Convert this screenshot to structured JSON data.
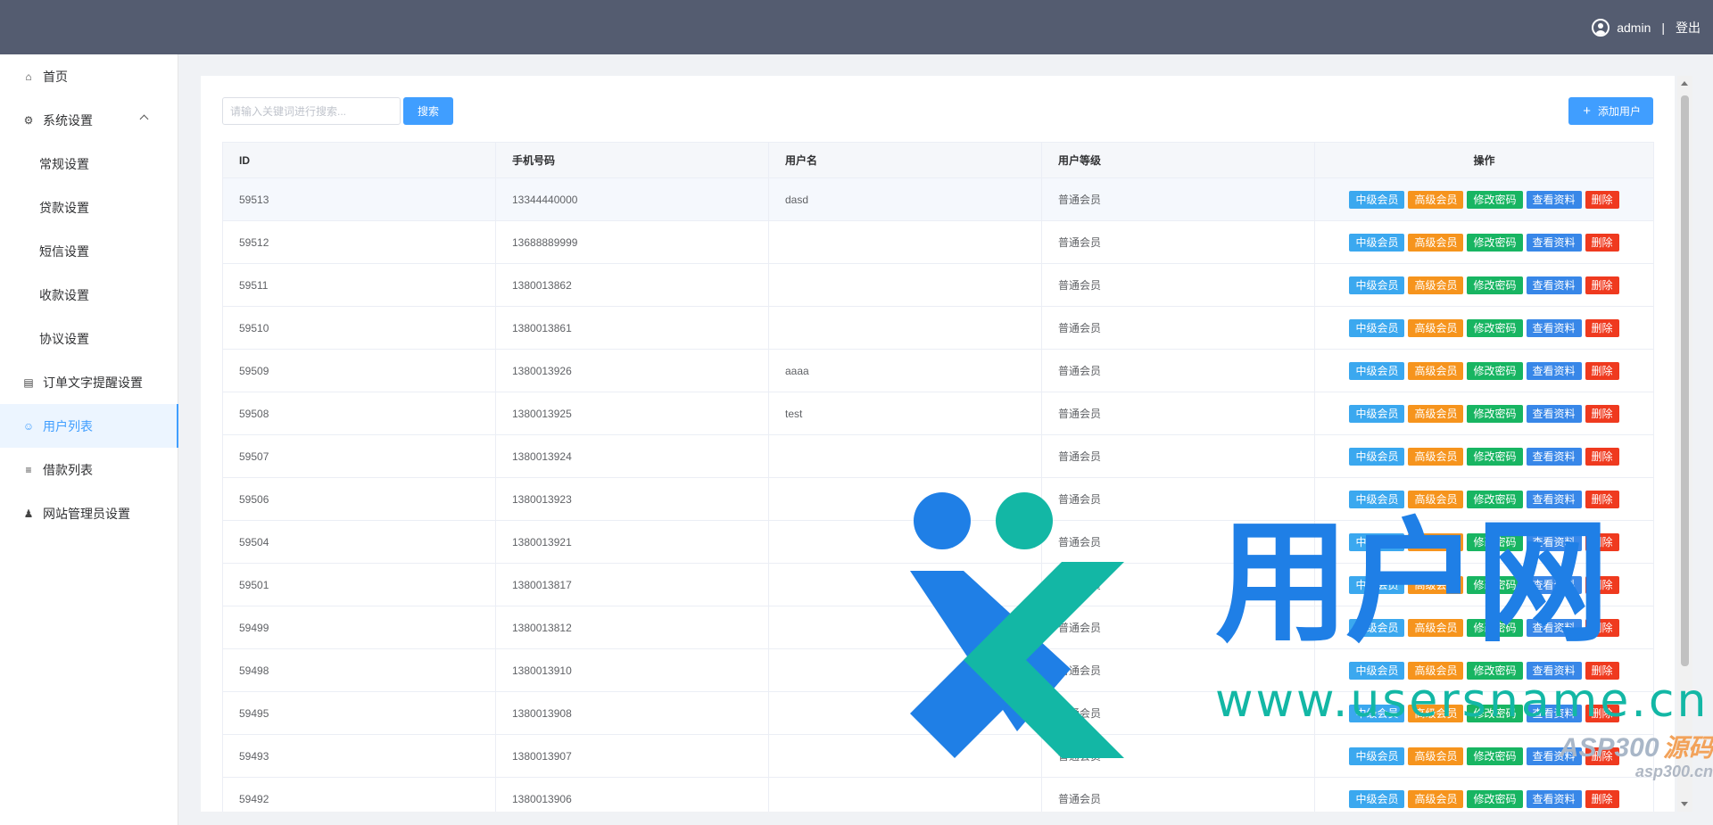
{
  "header": {
    "username": "admin",
    "separator": "|",
    "logout": "登出"
  },
  "sidebar": {
    "items": [
      {
        "label": "首页",
        "icon": "home-icon",
        "glyph": "⌂"
      },
      {
        "label": "系统设置",
        "icon": "gear-icon",
        "glyph": "⚙"
      },
      {
        "label": "常规设置"
      },
      {
        "label": "贷款设置"
      },
      {
        "label": "短信设置"
      },
      {
        "label": "收款设置"
      },
      {
        "label": "协议设置"
      },
      {
        "label": "订单文字提醒设置",
        "icon": "document-icon",
        "glyph": "▤"
      },
      {
        "label": "用户列表",
        "icon": "users-icon",
        "glyph": "☺"
      },
      {
        "label": "借款列表",
        "icon": "list-icon",
        "glyph": "≡"
      },
      {
        "label": "网站管理员设置",
        "icon": "user-icon",
        "glyph": "♟"
      }
    ]
  },
  "toolbar": {
    "search_placeholder": "请输入关键词进行搜索...",
    "search_label": "搜索",
    "add_label": "添加用户",
    "add_glyph": "+"
  },
  "table": {
    "headers": [
      "ID",
      "手机号码",
      "用户名",
      "用户等级",
      "操作"
    ],
    "actions": [
      "中级会员",
      "高级会员",
      "修改密码",
      "查看资料",
      "删除"
    ],
    "rows": [
      {
        "id": "59513",
        "phone": "13344440000",
        "username": "dasd",
        "level": "普通会员"
      },
      {
        "id": "59512",
        "phone": "13688889999",
        "username": "",
        "level": "普通会员"
      },
      {
        "id": "59511",
        "phone": "1380013862",
        "username": "",
        "level": "普通会员"
      },
      {
        "id": "59510",
        "phone": "1380013861",
        "username": "",
        "level": "普通会员"
      },
      {
        "id": "59509",
        "phone": "1380013926",
        "username": "aaaa",
        "level": "普通会员"
      },
      {
        "id": "59508",
        "phone": "1380013925",
        "username": "test",
        "level": "普通会员"
      },
      {
        "id": "59507",
        "phone": "1380013924",
        "username": "",
        "level": "普通会员"
      },
      {
        "id": "59506",
        "phone": "1380013923",
        "username": "",
        "level": "普通会员"
      },
      {
        "id": "59504",
        "phone": "1380013921",
        "username": "",
        "level": "普通会员"
      },
      {
        "id": "59501",
        "phone": "1380013817",
        "username": "",
        "level": "普通会员"
      },
      {
        "id": "59499",
        "phone": "1380013812",
        "username": "",
        "level": "普通会员"
      },
      {
        "id": "59498",
        "phone": "1380013910",
        "username": "",
        "level": "普通会员"
      },
      {
        "id": "59495",
        "phone": "1380013908",
        "username": "",
        "level": "普通会员"
      },
      {
        "id": "59493",
        "phone": "1380013907",
        "username": "",
        "level": "普通会员"
      },
      {
        "id": "59492",
        "phone": "1380013906",
        "username": "",
        "level": "普通会员"
      }
    ]
  },
  "watermark": {
    "logo_text": "用户网",
    "url": "www.usersname.cn",
    "asp_a": "ASP300",
    "asp_b": "源码",
    "asp_url": "asp300.cn"
  },
  "colors": {
    "header": "#545c70",
    "primary": "#409eff",
    "mid": "#3ba8ef",
    "adv": "#f6941d",
    "pwd": "#18b562",
    "view": "#3887e8",
    "del": "#ef3a1f"
  }
}
